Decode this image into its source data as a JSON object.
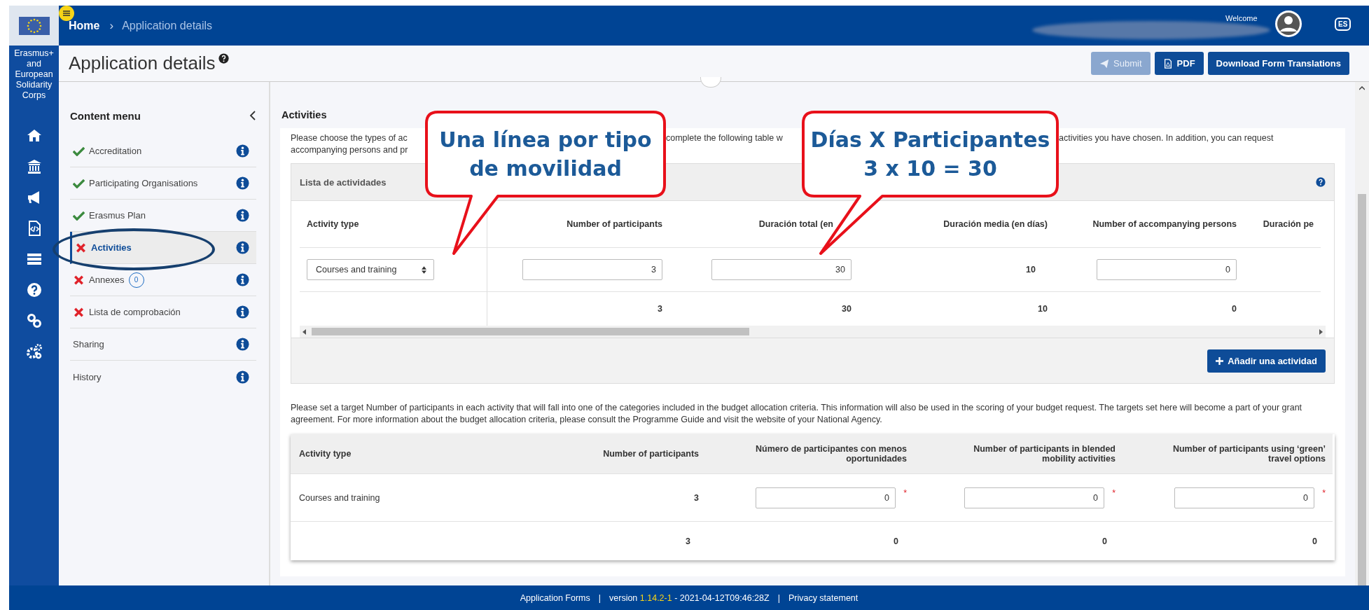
{
  "header": {
    "home": "Home",
    "separator": "›",
    "current": "Application details",
    "welcome": "Welcome",
    "language": "ES"
  },
  "sidebar": {
    "program": "Erasmus+ and European Solidarity Corps"
  },
  "page": {
    "title": "Application details",
    "buttons": [
      {
        "label": "Submit",
        "kind": "submit",
        "disabled": true
      },
      {
        "label": "PDF",
        "kind": "pdf",
        "disabled": false
      },
      {
        "label": "Download Form Translations",
        "kind": "plain",
        "disabled": false
      }
    ]
  },
  "content_menu": {
    "title": "Content menu",
    "items": [
      {
        "label": "Accreditation",
        "kind": "done",
        "selected": false
      },
      {
        "label": "Participating Organisations",
        "kind": "done",
        "selected": false
      },
      {
        "label": "Erasmus Plan",
        "kind": "done",
        "selected": false
      },
      {
        "label": "Activities",
        "kind": "error",
        "selected": true
      },
      {
        "label": "Annexes",
        "kind": "error",
        "badge": "0",
        "selected": false
      },
      {
        "label": "Lista de comprobación",
        "kind": "error",
        "selected": false
      },
      {
        "label": "Sharing",
        "kind": "plain",
        "selected": false
      },
      {
        "label": "History",
        "kind": "plain",
        "selected": false
      }
    ]
  },
  "section": {
    "title": "Activities",
    "intro_fragments": [
      "Please choose the types of ac",
      "complete the following table w",
      "activities you have chosen. In addition, you can request",
      "accompanying persons and pr"
    ],
    "activity_list": {
      "title": "Lista de actividades",
      "columns": [
        "Activity type",
        "Number of participants",
        "Duración total (en",
        "Duración media (en días)",
        "Number of accompanying persons",
        "Duración pe"
      ],
      "rows": [
        {
          "cells": [
            {
              "kind": "select",
              "value": "Courses and training"
            },
            {
              "kind": "input",
              "value": "3"
            },
            {
              "kind": "input",
              "value": "30"
            },
            {
              "kind": "text",
              "value": "10"
            },
            {
              "kind": "input",
              "value": "0"
            }
          ]
        }
      ],
      "totals": [
        "3",
        "30",
        "10",
        "0"
      ],
      "add_button": "Añadir una actividad"
    },
    "targets_note": "Please set a target Number of participants in each activity that will fall into one of the categories included in the budget allocation criteria. This information will also be used in the scoring of your budget request. The targets set here will become a part of your grant agreement. For more information about the budget allocation criteria, please consult the Programme Guide and visit the website of your National Agency.",
    "targets": {
      "columns": [
        "Activity type",
        "Number of participants",
        "Número de participantes con menos oportunidades",
        "Number of participants in blended mobility activities",
        "Number of participants using ‘green’ travel options"
      ],
      "rows": [
        {
          "activity_type": "Courses and training",
          "participants": "3",
          "inputs": [
            {
              "value": "0",
              "required_mark": "*"
            },
            {
              "value": "0",
              "required_mark": "*"
            },
            {
              "value": "0",
              "required_mark": "*"
            }
          ]
        }
      ],
      "totals": [
        "3",
        "0",
        "0",
        "0"
      ]
    }
  },
  "annotations": [
    {
      "kind": "callout",
      "lines": [
        "Una línea por tipo",
        "de movilidad"
      ]
    },
    {
      "kind": "callout",
      "lines": [
        "Días X Participantes",
        "3 x 10 = 30"
      ]
    },
    {
      "kind": "ellipse"
    }
  ],
  "footer": {
    "app_name": "Application Forms",
    "separator": "|",
    "version_prefix": "version",
    "version": "1.14.2-1",
    "build": "- 2021-04-12T09:46:28Z",
    "privacy": "Privacy statement"
  }
}
